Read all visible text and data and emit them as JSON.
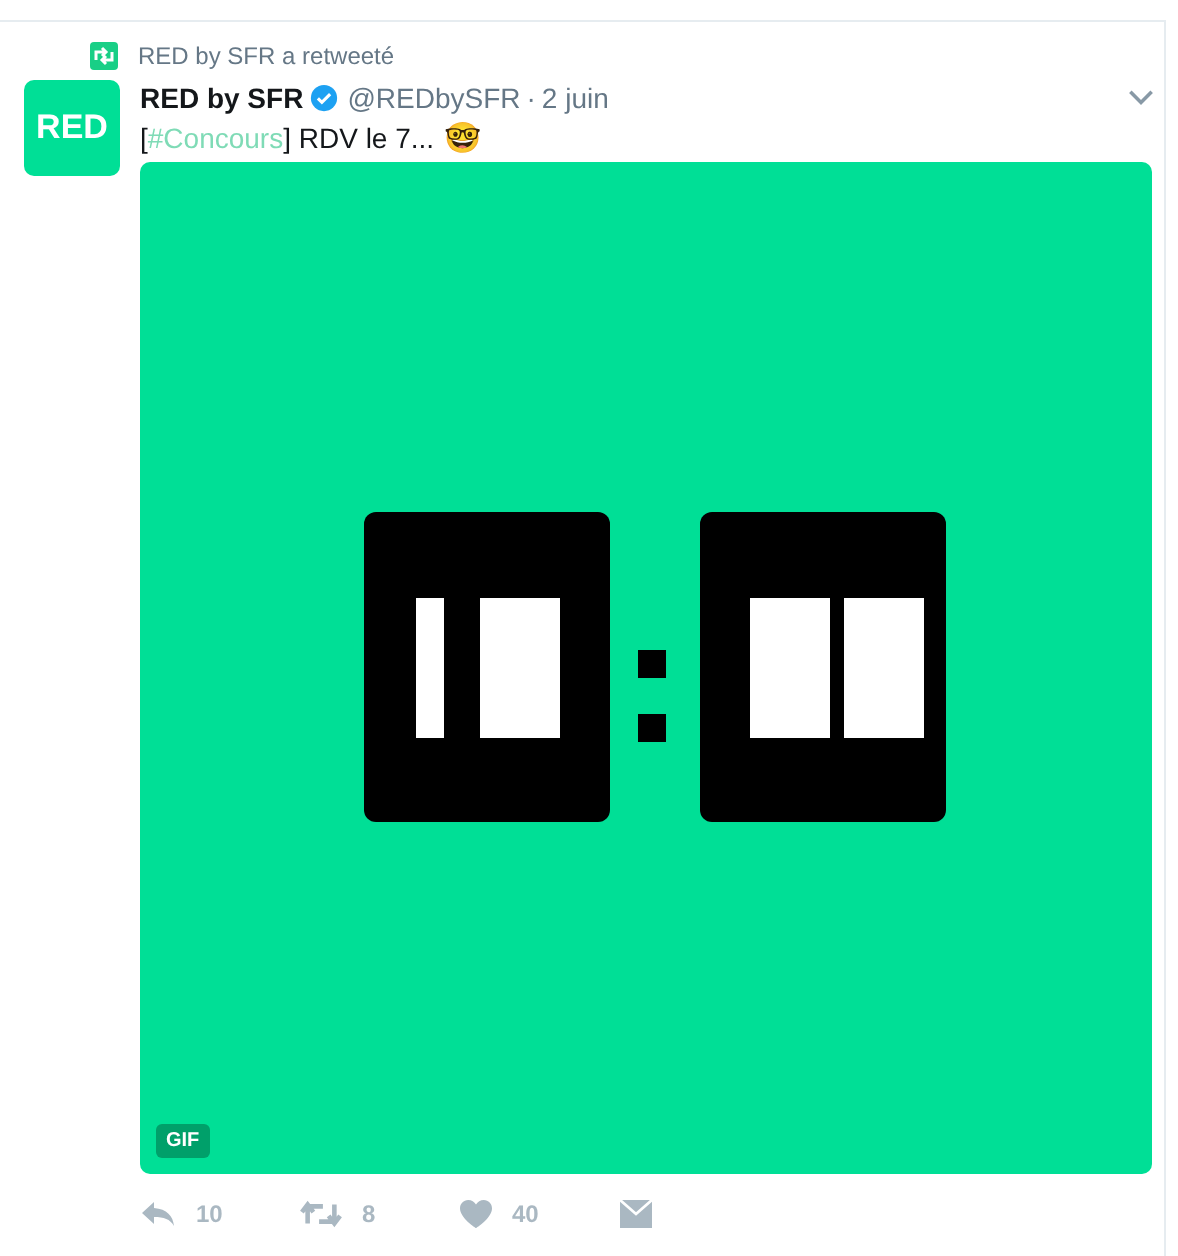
{
  "retweet_context": {
    "text": "RED by SFR a retweeté"
  },
  "tweet": {
    "avatar_text": "RED",
    "name": "RED by SFR",
    "verified": true,
    "handle": "@REDbySFR",
    "separator": "·",
    "date": "2 juin",
    "hashtag": "#Concours",
    "text_before": "[",
    "text_after": "] RDV le 7...",
    "emoji": "🤓"
  },
  "media": {
    "kind": "picture",
    "badge": "GIF"
  },
  "actions": [
    {
      "kind": "reply",
      "count": "10"
    },
    {
      "kind": "retweet",
      "count": "8"
    },
    {
      "kind": "like",
      "count": "40"
    },
    {
      "kind": "message"
    }
  ]
}
